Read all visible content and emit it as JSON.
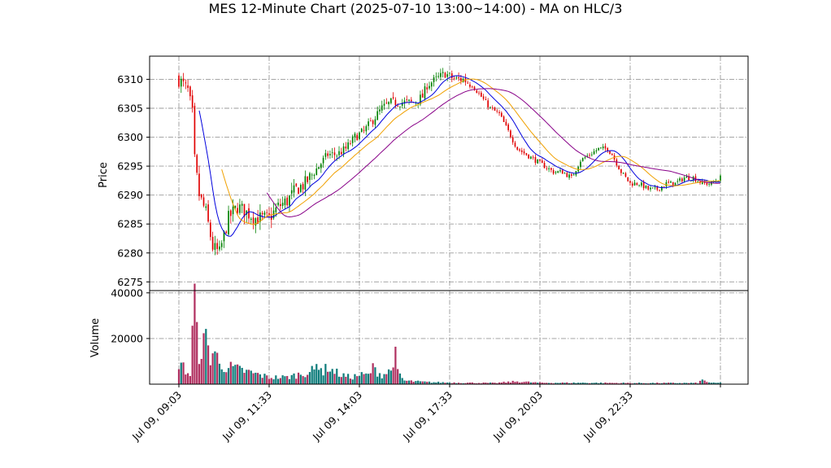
{
  "chart_data": {
    "type": "candlestick",
    "title": "MES 12-Minute Chart (2025-07-10 13:00~14:00) - MA on HLC/3",
    "price_panel": {
      "ylabel": "Price",
      "ylim": [
        6273.5,
        6314
      ],
      "yticks": [
        6275,
        6280,
        6285,
        6290,
        6295,
        6300,
        6305,
        6310
      ],
      "grid": true
    },
    "volume_panel": {
      "ylabel": "Volume",
      "ylim": [
        0,
        41000
      ],
      "yticks": [
        20000,
        40000
      ],
      "grid": true
    },
    "x_ticks": [
      {
        "label": "Jul 09, 09:03",
        "bar": 0
      },
      {
        "label": "Jul 09, 11:33",
        "bar": 40
      },
      {
        "label": "Jul 09, 14:03",
        "bar": 80
      },
      {
        "label": "Jul 09, 17:33",
        "bar": 120
      },
      {
        "label": "Jul 09, 20:03",
        "bar": 160
      },
      {
        "label": "Jul 09, 22:33",
        "bar": 200
      },
      {
        "label": "",
        "bar": 240
      }
    ],
    "bar_count": 241,
    "colors": {
      "up": "#008000",
      "down": "#e00000",
      "vol_up": "#0e7c7b",
      "vol_down": "#b03060"
    },
    "close_anchors": [
      [
        0,
        6310
      ],
      [
        4,
        6308
      ],
      [
        6,
        6304
      ],
      [
        7,
        6296
      ],
      [
        9,
        6290
      ],
      [
        12,
        6287
      ],
      [
        15,
        6281
      ],
      [
        18,
        6280
      ],
      [
        20,
        6283
      ],
      [
        22,
        6286
      ],
      [
        26,
        6288
      ],
      [
        30,
        6287
      ],
      [
        34,
        6286
      ],
      [
        36,
        6286
      ],
      [
        40,
        6286
      ],
      [
        44,
        6288
      ],
      [
        48,
        6289
      ],
      [
        52,
        6291
      ],
      [
        56,
        6292
      ],
      [
        60,
        6294
      ],
      [
        64,
        6296
      ],
      [
        66,
        6297
      ],
      [
        70,
        6297
      ],
      [
        74,
        6298
      ],
      [
        78,
        6300
      ],
      [
        82,
        6301
      ],
      [
        86,
        6303
      ],
      [
        90,
        6305
      ],
      [
        94,
        6306
      ],
      [
        98,
        6306
      ],
      [
        100,
        6306
      ],
      [
        104,
        6306
      ],
      [
        108,
        6307
      ],
      [
        110,
        6309
      ],
      [
        114,
        6310
      ],
      [
        118,
        6311
      ],
      [
        122,
        6310
      ],
      [
        126,
        6310
      ],
      [
        130,
        6309
      ],
      [
        134,
        6307
      ],
      [
        138,
        6305
      ],
      [
        142,
        6304
      ],
      [
        146,
        6301
      ],
      [
        150,
        6298
      ],
      [
        154,
        6297
      ],
      [
        158,
        6296
      ],
      [
        162,
        6295
      ],
      [
        166,
        6294
      ],
      [
        170,
        6294
      ],
      [
        174,
        6293
      ],
      [
        178,
        6296
      ],
      [
        182,
        6297
      ],
      [
        186,
        6298
      ],
      [
        190,
        6298
      ],
      [
        192,
        6297
      ],
      [
        196,
        6294
      ],
      [
        200,
        6292
      ],
      [
        204,
        6292
      ],
      [
        208,
        6291
      ],
      [
        212,
        6291
      ],
      [
        216,
        6292
      ],
      [
        220,
        6292
      ],
      [
        224,
        6293
      ],
      [
        228,
        6293
      ],
      [
        232,
        6292
      ],
      [
        236,
        6292
      ],
      [
        240,
        6293
      ]
    ],
    "volume_anchors": [
      [
        0,
        10000
      ],
      [
        3,
        6000
      ],
      [
        5,
        4000
      ],
      [
        6,
        21000
      ],
      [
        7,
        39000
      ],
      [
        8,
        20000
      ],
      [
        9,
        14000
      ],
      [
        12,
        19000
      ],
      [
        14,
        12000
      ],
      [
        16,
        15000
      ],
      [
        18,
        8000
      ],
      [
        20,
        8000
      ],
      [
        24,
        7000
      ],
      [
        28,
        6000
      ],
      [
        32,
        5000
      ],
      [
        36,
        4000
      ],
      [
        40,
        3000
      ],
      [
        44,
        3000
      ],
      [
        48,
        3000
      ],
      [
        52,
        4000
      ],
      [
        56,
        5000
      ],
      [
        60,
        6000
      ],
      [
        62,
        10000
      ],
      [
        64,
        5000
      ],
      [
        66,
        8000
      ],
      [
        68,
        6000
      ],
      [
        72,
        4000
      ],
      [
        76,
        3000
      ],
      [
        80,
        4000
      ],
      [
        84,
        4000
      ],
      [
        86,
        7000
      ],
      [
        90,
        4000
      ],
      [
        94,
        6000
      ],
      [
        95,
        12000
      ],
      [
        96,
        12000
      ],
      [
        97,
        5000
      ],
      [
        100,
        1500
      ],
      [
        110,
        900
      ],
      [
        120,
        700
      ],
      [
        130,
        600
      ],
      [
        140,
        500
      ],
      [
        150,
        1200
      ],
      [
        160,
        600
      ],
      [
        180,
        600
      ],
      [
        200,
        500
      ],
      [
        230,
        500
      ],
      [
        232,
        1800
      ],
      [
        236,
        500
      ],
      [
        240,
        600
      ]
    ],
    "moving_averages": [
      {
        "color": "#0000dd",
        "window": 10
      },
      {
        "color": "#f0a000",
        "window": 20
      },
      {
        "color": "#880088",
        "window": 40
      }
    ]
  }
}
